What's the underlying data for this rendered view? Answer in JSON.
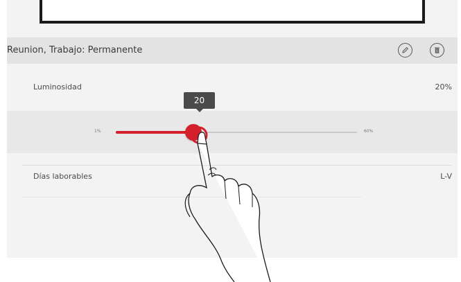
{
  "header": {
    "title": "Reunion, Trabajo: Permanente",
    "edit_icon": "pencil-icon",
    "delete_icon": "trash-icon"
  },
  "brightness": {
    "label": "Luminosidad",
    "value_text": "20%",
    "tooltip": "20",
    "min_label": "1%",
    "max_label": "60%",
    "slider_value": 20
  },
  "workdays": {
    "label": "Días laborables",
    "value": "L-V"
  },
  "colors": {
    "accent": "#d3202b",
    "tooltip_bg": "#4a4a4a",
    "header_bg": "#e3e3e3"
  }
}
